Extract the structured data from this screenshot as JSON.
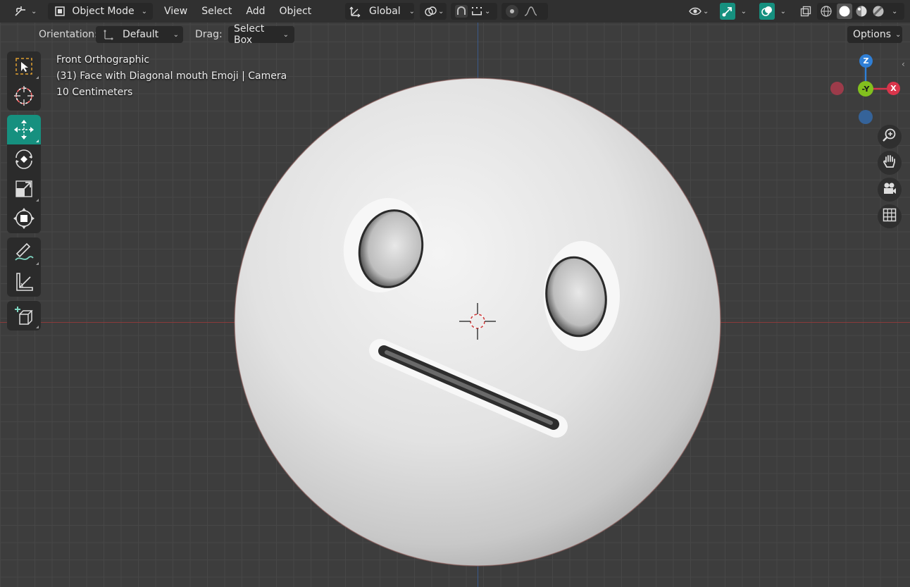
{
  "header": {
    "editor_type_icon": "viewport-editor-icon",
    "mode_label": "Object Mode",
    "menus": [
      "View",
      "Select",
      "Add",
      "Object"
    ],
    "transform_orientation": "Global",
    "icons": [
      "transform-pivot-icon",
      "snap-icon",
      "proportional-edit-icon",
      "visibility-icon",
      "gizmo-icon",
      "overlay-icon",
      "xray-icon",
      "shading-wireframe-icon",
      "shading-solid-icon",
      "shading-material-icon",
      "shading-rendered-icon"
    ]
  },
  "toolsettings": {
    "orientation_label": "Orientation:",
    "orientation_value": "Default",
    "drag_label": "Drag:",
    "drag_value": "Select Box",
    "options_label": "Options"
  },
  "toolbar": {
    "tools": [
      "select-box-tool-icon",
      "cursor-tool-icon",
      "move-tool-icon",
      "rotate-tool-icon",
      "scale-tool-icon",
      "transform-tool-icon",
      "annotate-tool-icon",
      "measure-tool-icon",
      "add-cube-tool-icon"
    ],
    "active_tool": "move-tool-icon"
  },
  "overlay": {
    "view_name": "Front Orthographic",
    "object_info": "(31) Face with Diagonal mouth Emoji | Camera",
    "scale": "10 Centimeters"
  },
  "gizmo": {
    "z_label": "Z",
    "y_label": "-Y",
    "x_label": "X",
    "colors": {
      "x": "#d9354b",
      "y": "#82c01e",
      "z": "#2f7fd6"
    }
  },
  "nav_buttons": [
    "zoom-icon",
    "pan-hand-icon",
    "camera-view-icon",
    "grid-view-icon"
  ],
  "colors": {
    "accent": "#16907f",
    "header_bg": "#303030",
    "viewport_bg": "#3d3d3d"
  }
}
